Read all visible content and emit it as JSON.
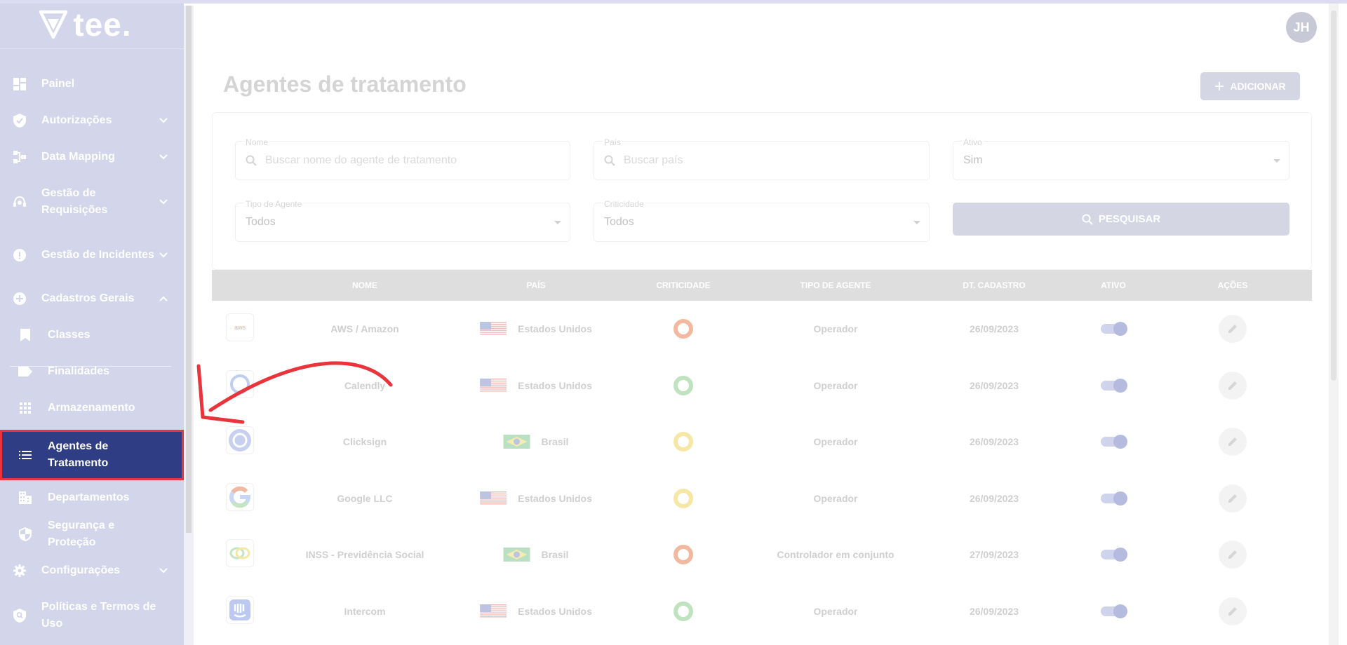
{
  "brand": {
    "name": "tee."
  },
  "user": {
    "initials": "JH"
  },
  "sidebar": {
    "items": [
      {
        "label": "Painel",
        "icon": "dashboard-icon"
      },
      {
        "label": "Autorizações",
        "icon": "shield-check-icon"
      },
      {
        "label": "Data Mapping",
        "icon": "data-mapping-icon"
      },
      {
        "label": "Gestão de Requisições",
        "icon": "support-agent-icon"
      },
      {
        "label": "Gestão de Incidentes",
        "icon": "alert-icon"
      },
      {
        "label": "Cadastros Gerais",
        "icon": "plus-circle-icon"
      },
      {
        "label": "Classes",
        "icon": "bookmark-icon"
      },
      {
        "label": "Finalidades",
        "icon": "label-icon"
      },
      {
        "label": "Armazenamento",
        "icon": "apps-grid-icon"
      },
      {
        "label": "Agentes de Tratamento",
        "icon": "list-icon"
      },
      {
        "label": "Departamentos",
        "icon": "building-icon"
      },
      {
        "label": "Segurança e Proteção",
        "icon": "security-icon"
      },
      {
        "label": "Configurações",
        "icon": "gear-icon"
      },
      {
        "label": "Políticas e Termos de Uso",
        "icon": "policy-icon"
      }
    ]
  },
  "page": {
    "title": "Agentes de tratamento",
    "add_label": "ADICIONAR"
  },
  "filters": {
    "name": {
      "label": "Nome",
      "placeholder": "Buscar nome do agente de tratamento"
    },
    "country": {
      "label": "País",
      "placeholder": "Buscar país"
    },
    "active": {
      "label": "Ativo",
      "value": "Sim"
    },
    "agent_type": {
      "label": "Tipo de Agente",
      "value": "Todos"
    },
    "criticality": {
      "label": "Criticidade",
      "value": "Todos"
    },
    "search_label": "PESQUISAR"
  },
  "table": {
    "headers": [
      "NOME",
      "PAÍS",
      "CRITICIDADE",
      "TIPO DE AGENTE",
      "DT. CADASTRO",
      "ATIVO",
      "AÇÕES"
    ],
    "rows": [
      {
        "logo": "aws",
        "name": "AWS / Amazon",
        "country": "Estados Unidos",
        "flag": "us",
        "criticality_color": "#f3b9a0",
        "type": "Operador",
        "date": "26/09/2023"
      },
      {
        "logo": "calendly",
        "name": "Calendly",
        "country": "Estados Unidos",
        "flag": "us",
        "criticality_color": "#bfe3bf",
        "type": "Operador",
        "date": "26/09/2023"
      },
      {
        "logo": "clicksign",
        "name": "Clicksign",
        "country": "Brasil",
        "flag": "br",
        "criticality_color": "#f6e7a5",
        "type": "Operador",
        "date": "26/09/2023"
      },
      {
        "logo": "google",
        "name": "Google LLC",
        "country": "Estados Unidos",
        "flag": "us",
        "criticality_color": "#f6e7a5",
        "type": "Operador",
        "date": "26/09/2023"
      },
      {
        "logo": "inss",
        "name": "INSS - Previdência Social",
        "country": "Brasil",
        "flag": "br",
        "criticality_color": "#f3b9a0",
        "type": "Controlador em conjunto",
        "date": "27/09/2023"
      },
      {
        "logo": "intercom",
        "name": "Intercom",
        "country": "Estados Unidos",
        "flag": "us",
        "criticality_color": "#bfe3bf",
        "type": "Operador",
        "date": "26/09/2023"
      }
    ]
  },
  "colors": {
    "sidebar_bg": "#d3d6ea",
    "active_item_bg": "#2e3d84",
    "highlight": "#e8343a"
  }
}
